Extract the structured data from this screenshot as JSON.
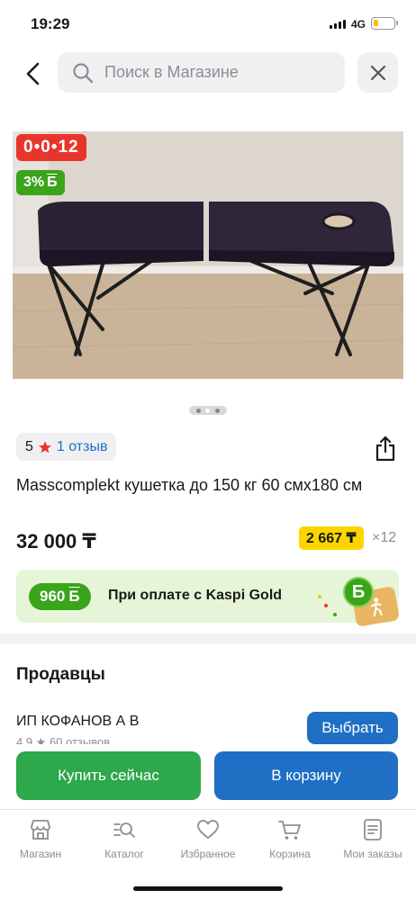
{
  "status_bar": {
    "time": "19:29",
    "network": "4G"
  },
  "search": {
    "placeholder": "Поиск в Магазине"
  },
  "product": {
    "timer_badge": "0•0•12",
    "bonus_badge": "3%",
    "bonus_symbol": "Б",
    "gallery_pages": 3,
    "gallery_current": 2,
    "rating": "5",
    "reviews_link": "1 отзыв",
    "title": "Masscomplekt кушетка до 150 кг 60 смх180 см",
    "price": "32 000 ₸",
    "monthly_payment": "2 667 ₸",
    "installments": "×12"
  },
  "promo": {
    "bonus_amount": "960",
    "bonus_symbol": "Б",
    "text": "При оплате с Kaspi Gold"
  },
  "sellers": {
    "heading": "Продавцы",
    "seller_name": "ИП КОФАНОВ А В",
    "seller_meta": "4.9 ★ 60 отзывов",
    "choose_label": "Выбрать"
  },
  "actions": {
    "buy_now": "Купить сейчас",
    "add_to_cart": "В корзину"
  },
  "tabs": [
    {
      "label": "Магазин",
      "icon": "store-icon"
    },
    {
      "label": "Каталог",
      "icon": "catalog-search-icon"
    },
    {
      "label": "Избранное",
      "icon": "heart-icon"
    },
    {
      "label": "Корзина",
      "icon": "cart-icon"
    },
    {
      "label": "Мои заказы",
      "icon": "orders-icon"
    }
  ],
  "colors": {
    "accent_blue": "#1f6fc5",
    "buy_green": "#2da84a",
    "badge_red": "#e8352b",
    "bonus_green": "#3aa41b",
    "installment_yellow": "#fcd500"
  }
}
